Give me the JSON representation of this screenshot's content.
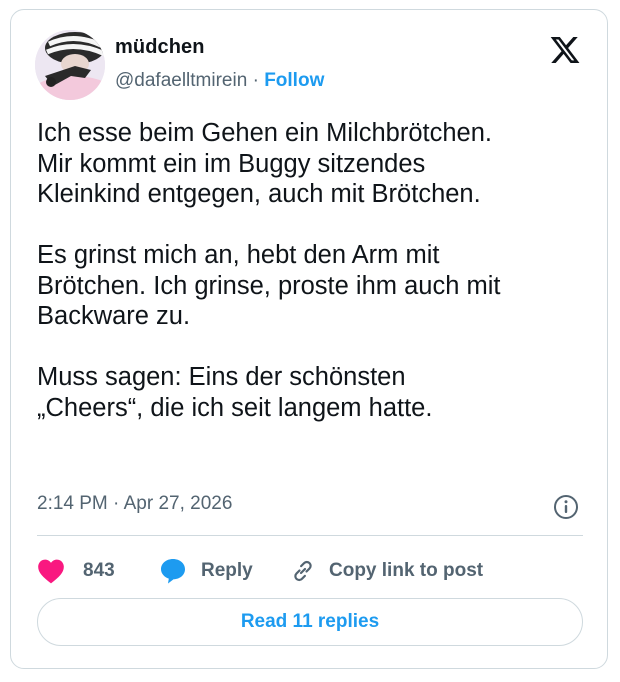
{
  "author": {
    "display_name": "müdchen",
    "handle": "@dafaelltmirein",
    "separator": "·",
    "follow_label": "Follow"
  },
  "tweet": {
    "text": "Ich esse beim Gehen ein Milchbrötchen.\nMir kommt ein im Buggy sitzendes\nKleinkind entgegen, auch mit Brötchen.\n\nEs grinst mich an, hebt den Arm mit\nBrötchen. Ich grinse, proste ihm auch mit\nBackware zu.\n\nMuss sagen: Eins der schönsten\n„Cheers“, die ich seit langem hatte.",
    "timestamp": "2:14 PM · Apr 27, 2026"
  },
  "actions": {
    "like_count": "843",
    "reply_label": "Reply",
    "copy_link_label": "Copy link to post",
    "read_replies_label": "Read 11 replies"
  },
  "icons": {
    "brand": "x-logo-icon",
    "info": "info-icon",
    "like": "heart-icon",
    "reply": "speech-bubble-icon",
    "copy_link": "link-icon"
  },
  "colors": {
    "accent": "#1d9bf0",
    "like": "#f91880",
    "text": "#0f1419",
    "secondary": "#536471",
    "border": "#cfd9de"
  }
}
